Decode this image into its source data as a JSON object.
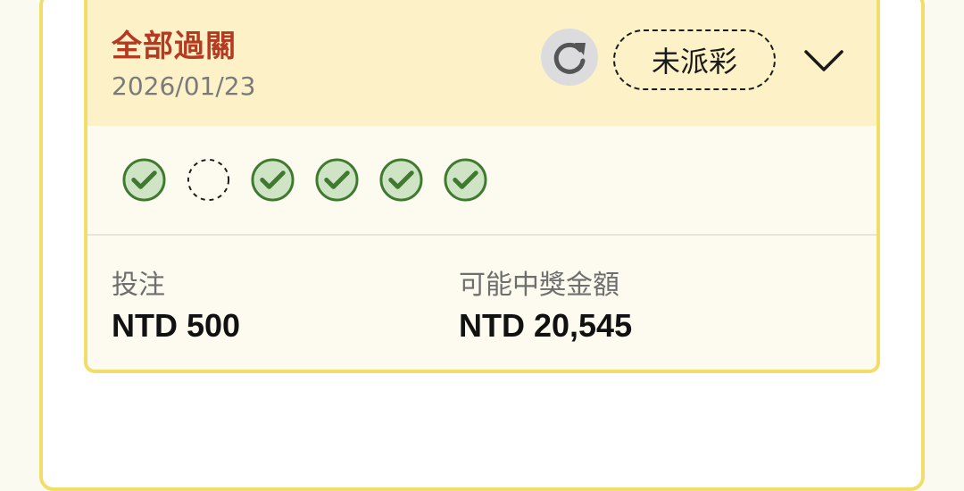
{
  "bet": {
    "title": "全部過關",
    "date": "2026/01/23",
    "status": "未派彩",
    "legs": [
      {
        "state": "won",
        "icon": "check-circle-icon"
      },
      {
        "state": "pending",
        "icon": "dashed-circle-icon"
      },
      {
        "state": "won",
        "icon": "check-circle-icon"
      },
      {
        "state": "won",
        "icon": "check-circle-icon"
      },
      {
        "state": "won",
        "icon": "check-circle-icon"
      },
      {
        "state": "won",
        "icon": "check-circle-icon"
      }
    ],
    "stake_label": "投注",
    "stake_value": "NTD 500",
    "payout_label": "可能中獎金額",
    "payout_value": "NTD 20,545"
  },
  "icons": {
    "refresh": "refresh-icon",
    "expand": "chevron-down-icon"
  },
  "colors": {
    "title": "#b63a22",
    "header_bg": "#fdf2c7",
    "card_border": "#f1de6a",
    "won": "#3f7a2f",
    "won_fill": "#cfe3c5"
  }
}
